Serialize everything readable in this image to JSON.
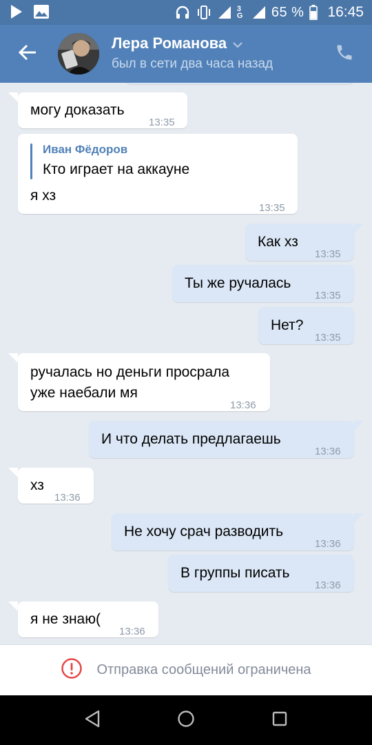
{
  "status_bar": {
    "network": "3G",
    "battery": "65 %",
    "time": "16:45"
  },
  "header": {
    "name": "Лера Романова",
    "status": "был в сети два часа назад"
  },
  "messages": [
    {
      "dir": "in",
      "text": "могу доказать",
      "time": "13:35"
    },
    {
      "dir": "in",
      "quote_author": "Иван Фёдоров",
      "quote_text": "Кто играет на аккауне",
      "text": "я хз",
      "time": "13:35"
    },
    {
      "dir": "out",
      "text": "Как хз",
      "time": "13:35"
    },
    {
      "dir": "out",
      "text": "Ты же ручалась",
      "time": "13:35"
    },
    {
      "dir": "out",
      "text": "Нет?",
      "time": "13:35"
    },
    {
      "dir": "in",
      "text_line1": "ручалась но деньги просрала",
      "text_line2": "уже наебали мя",
      "time": "13:36"
    },
    {
      "dir": "out",
      "text": "И что делать предлагаешь",
      "time": "13:36"
    },
    {
      "dir": "in",
      "text": "хз",
      "time": "13:36"
    },
    {
      "dir": "out",
      "text": "Не хочу срач разводить",
      "time": "13:36"
    },
    {
      "dir": "out",
      "text": "В группы писать",
      "time": "13:36"
    },
    {
      "dir": "in",
      "text": "я не знаю(",
      "time": "13:36"
    }
  ],
  "restriction": {
    "text": "Отправка сообщений ограничена"
  },
  "colors": {
    "accent": "#5181b8",
    "status_bar": "#4a76a8",
    "chat_bg": "#e6ebf1",
    "outgoing_bubble": "#dbe7f6",
    "incoming_bubble": "#ffffff",
    "warning": "#e64646"
  },
  "icons": {
    "back": "arrow-left-icon",
    "call": "phone-icon",
    "dropdown": "chevron-down-icon",
    "warning": "exclamation-circle-icon"
  }
}
